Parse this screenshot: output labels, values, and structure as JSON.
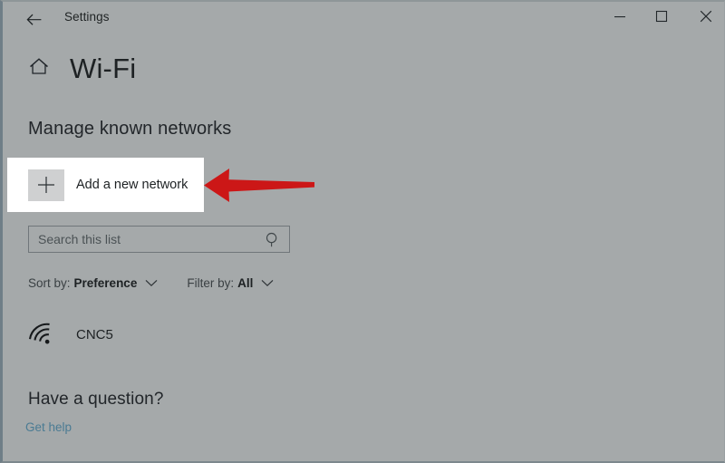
{
  "window": {
    "titlebar": {
      "back_label": "back-arrow",
      "title": "Settings",
      "controls": [
        {
          "name": "minimize",
          "glyph": "minimize-icon"
        },
        {
          "name": "maximize",
          "glyph": "maximize-icon"
        },
        {
          "name": "close",
          "glyph": "close-icon"
        }
      ]
    },
    "background_color": "#a5a9aa"
  },
  "header": {
    "home_icon": "home-icon",
    "title": "Wi-Fi"
  },
  "section": {
    "heading": "Manage known networks"
  },
  "add_network": {
    "label": "Add a new network",
    "icon": "plus-icon",
    "card_background": "#ffffff"
  },
  "annotation": {
    "arrow": {
      "icon": "left-arrow-annotation",
      "color": "#cc1717",
      "direction": "left"
    }
  },
  "search": {
    "value": "",
    "placeholder": "Search this list",
    "icon": "search-icon"
  },
  "list_controls": [
    {
      "label": "Sort by:",
      "value": "Preference",
      "icon": "chevron-down-icon"
    },
    {
      "label": "Filter by:",
      "value": "All",
      "icon": "chevron-down-icon"
    }
  ],
  "networks": [
    {
      "name": "CNC5",
      "icon": "wifi-signal-icon"
    }
  ],
  "footer": {
    "heading": "Have a question?",
    "link": "Get help",
    "link_color": "#4a7b93"
  }
}
